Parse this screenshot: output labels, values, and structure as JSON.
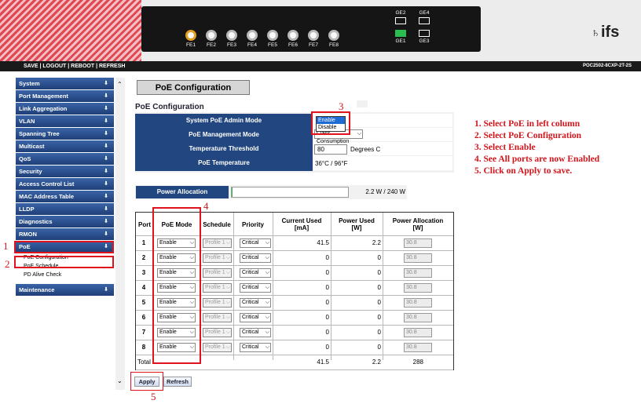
{
  "header": {
    "logo_text": "ifs",
    "ports": [
      {
        "label": "FE1",
        "active": true
      },
      {
        "label": "FE2",
        "active": false
      },
      {
        "label": "FE3",
        "active": false
      },
      {
        "label": "FE4",
        "active": false
      },
      {
        "label": "FE5",
        "active": false
      },
      {
        "label": "FE6",
        "active": false
      },
      {
        "label": "FE7",
        "active": false
      },
      {
        "label": "FE8",
        "active": false
      }
    ],
    "sfp_top": [
      "GE2",
      "GE4"
    ],
    "sfp_bottom": [
      "GE1",
      "GE3"
    ],
    "toolbar_text": "SAVE | LOGOUT | REBOOT | REFRESH",
    "model": "POC2502-8CXP-2T-2S"
  },
  "sidebar": {
    "items": [
      "System",
      "Port Management",
      "Link Aggregation",
      "VLAN",
      "Spanning Tree",
      "Multicast",
      "QoS",
      "Security",
      "Access Control List",
      "MAC Address Table",
      "LLDP",
      "Diagnostics",
      "RMON",
      "PoE"
    ],
    "subitems": [
      "PoE Configuration",
      "PoE Schedule",
      "PD Alive Check"
    ],
    "last_item": "Maintenance"
  },
  "page": {
    "title": "PoE Configuration",
    "section": "PoE Configuration",
    "system_admin_label": "System PoE Admin Mode",
    "admin_options": [
      "Enable",
      "Disable"
    ],
    "mgmt_label": "PoE Management Mode",
    "mgmt_value": "Class Consumption",
    "temp_label": "Temperature Threshold",
    "temp_value": "80",
    "temp_unit": "Degrees C",
    "ptemp_label": "PoE Temperature",
    "ptemp_value": "36°C / 96°F",
    "alloc_label": "Power Allocation",
    "alloc_value": "2.2 W / 240 W",
    "alloc_fraction": 0.009
  },
  "table": {
    "headers": {
      "port": "Port",
      "mode": "PoE Mode",
      "schedule": "Schedule",
      "priority": "Priority",
      "current": "Current Used\n[mA]",
      "power": "Power Used\n[W]",
      "alloc": "Power Allocation\n[W]"
    },
    "rows": [
      {
        "port": "1",
        "mode": "Enable",
        "schedule": "Profile 1",
        "priority": "Critical",
        "current": "41.5",
        "power": "2.2",
        "alloc": "30.8"
      },
      {
        "port": "2",
        "mode": "Enable",
        "schedule": "Profile 1",
        "priority": "Critical",
        "current": "0",
        "power": "0",
        "alloc": "30.8"
      },
      {
        "port": "3",
        "mode": "Enable",
        "schedule": "Profile 1",
        "priority": "Critical",
        "current": "0",
        "power": "0",
        "alloc": "30.8"
      },
      {
        "port": "4",
        "mode": "Enable",
        "schedule": "Profile 1",
        "priority": "Critical",
        "current": "0",
        "power": "0",
        "alloc": "30.8"
      },
      {
        "port": "5",
        "mode": "Enable",
        "schedule": "Profile 1",
        "priority": "Critical",
        "current": "0",
        "power": "0",
        "alloc": "30.8"
      },
      {
        "port": "6",
        "mode": "Enable",
        "schedule": "Profile 1",
        "priority": "Critical",
        "current": "0",
        "power": "0",
        "alloc": "30.8"
      },
      {
        "port": "7",
        "mode": "Enable",
        "schedule": "Profile 1",
        "priority": "Critical",
        "current": "0",
        "power": "0",
        "alloc": "30.8"
      },
      {
        "port": "8",
        "mode": "Enable",
        "schedule": "Profile 1",
        "priority": "Critical",
        "current": "0",
        "power": "0",
        "alloc": "30.8"
      }
    ],
    "total_label": "Total",
    "total_current": "41.5",
    "total_power": "2.2",
    "total_alloc": "288"
  },
  "buttons": {
    "apply": "Apply",
    "refresh": "Refresh"
  },
  "annotations": {
    "n1": "1",
    "n2": "2",
    "n3": "3",
    "n4": "4",
    "n5": "5",
    "instructions": [
      "1. Select PoE in left column",
      "2. Select PoE Configuration",
      "3. Select Enable",
      "4. See All ports are now Enabled",
      "5. Click on Apply to save."
    ]
  },
  "colors": {
    "menu_blue": "#22467f",
    "annotation_red": "#e0121b"
  }
}
